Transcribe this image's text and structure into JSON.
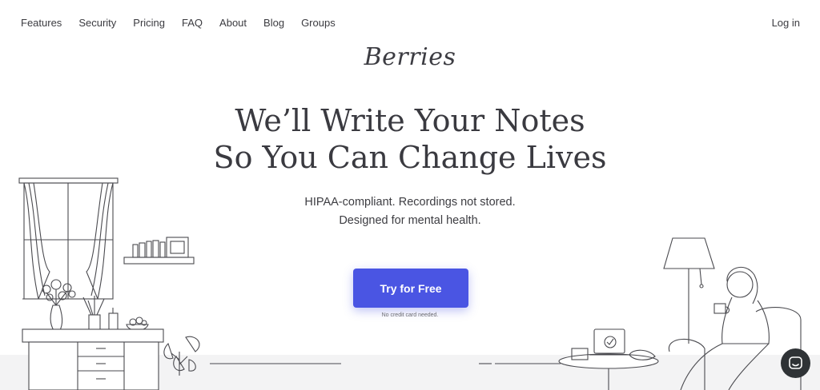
{
  "nav": {
    "links": [
      "Features",
      "Security",
      "Pricing",
      "FAQ",
      "About",
      "Blog",
      "Groups"
    ],
    "login": "Log in"
  },
  "logo": "Berries",
  "hero": {
    "headline_line1": "We’ll Write Your Notes",
    "headline_line2": "So You Can Change Lives",
    "sub_line1": "HIPAA-compliant. Recordings not stored.",
    "sub_line2": "Designed for mental health.",
    "cta_label": "Try for Free",
    "cta_note": "No credit card needed."
  },
  "colors": {
    "accent": "#4a55e3",
    "text": "#3a3a40",
    "floor": "#f3f3f4",
    "chat_bubble": "#2f3336"
  },
  "icons": {
    "chat": "chat-bubble-icon"
  }
}
